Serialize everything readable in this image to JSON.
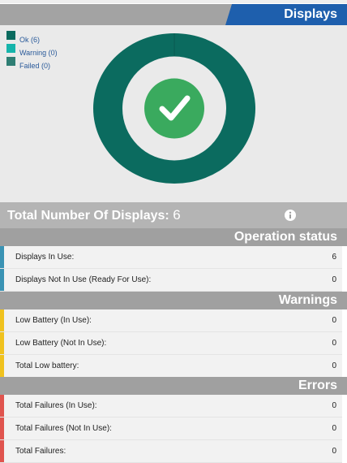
{
  "header": {
    "title": "Displays"
  },
  "legend": [
    {
      "label": "Ok (6)",
      "color": "#0b6b5f"
    },
    {
      "label": "Warning (0)",
      "color": "#16b4ab"
    },
    {
      "label": "Failed (0)",
      "color": "#2f7e74"
    }
  ],
  "chart_data": {
    "type": "pie",
    "categories": [
      "Ok",
      "Warning",
      "Failed"
    ],
    "values": [
      6,
      0,
      0
    ],
    "colors": [
      "#0b6b5f",
      "#16b4ab",
      "#2f7e74"
    ],
    "center_icon": "check-icon",
    "center_color": "#3aaa5e"
  },
  "total": {
    "label": "Total Number Of Displays:",
    "value": "6"
  },
  "sections": {
    "operation": {
      "title": "Operation status",
      "accent": "#3a93b4",
      "rows": [
        {
          "label": "Displays In Use:",
          "value": "6"
        },
        {
          "label": "Displays Not In Use (Ready For Use):",
          "value": "0"
        }
      ]
    },
    "warnings": {
      "title": "Warnings",
      "accent": "#f0c21e",
      "rows": [
        {
          "label": "Low Battery (In Use):",
          "value": "0"
        },
        {
          "label": "Low Battery (Not In Use):",
          "value": "0"
        },
        {
          "label": "Total Low battery:",
          "value": "0"
        }
      ]
    },
    "errors": {
      "title": "Errors",
      "accent": "#e0544e",
      "rows": [
        {
          "label": "Total Failures (In Use):",
          "value": "0"
        },
        {
          "label": "Total Failures (Not In Use):",
          "value": "0"
        },
        {
          "label": "Total Failures:",
          "value": "0"
        }
      ]
    }
  }
}
